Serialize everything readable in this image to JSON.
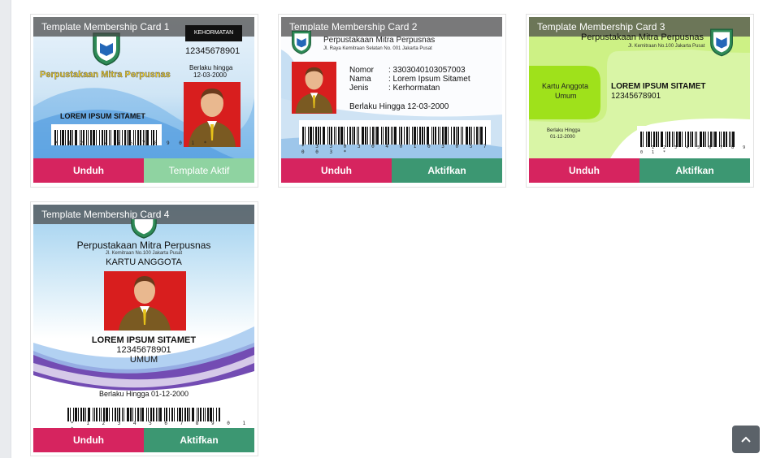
{
  "cards": [
    {
      "title": "Template Membership Card 1",
      "library": "Perpustakaan Mitra Perpusnas",
      "badge": "KEHORMATAN",
      "number": "12345678901",
      "valid_label": "Berlaku hingga",
      "valid_date": "12-03-2000",
      "name": "LOREM IPSUM SITAMET",
      "barcode_digits": "* 1 2 3 4 5 6 7 8 9 0 1 *",
      "download_label": "Unduh",
      "activate_label": "Template Aktif"
    },
    {
      "title": "Template Membership Card 2",
      "library": "Perpustakaan Mitra Perpusnas",
      "address": "Jl. Raya Kemitraan Selatan No. 001 Jakarta Pusat",
      "field_labels": [
        "Nomor",
        "Nama",
        "Jenis"
      ],
      "field_values": [
        ": 3303040103057003",
        ": Lorem Ipsum Sitamet",
        ": Kerhormatan"
      ],
      "valid_text": "Berlaku Hingga 12-03-2000",
      "barcode_digits": "* 3 3 0 3 0 4 0 1 0 3 0 5 7 0 0 3 *",
      "download_label": "Unduh",
      "activate_label": "Aktifkan"
    },
    {
      "title": "Template Membership Card 3",
      "library": "Perpustakaan Mitra Perpusnas",
      "address": "Jl. Kemitraan No.100 Jakarta Pusat",
      "member_type": "Kartu Anggota",
      "member_class": "Umum",
      "name": "LOREM IPSUM SITAMET",
      "number": "12345678901",
      "valid_label": "Berlaku Hingga",
      "valid_date": "01-12-2000",
      "barcode_digits": "* 1 2 3 4 5 6 7 8 9 0 1 *",
      "download_label": "Unduh",
      "activate_label": "Aktifkan"
    },
    {
      "title": "Template Membership Card 4",
      "library": "Perpustakaan Mitra Perpusnas",
      "address": "Jl. Kemitraan No.100 Jakarta Pusat",
      "heading": "KARTU ANGGOTA",
      "name": "LOREM IPSUM SITAMET",
      "number": "12345678901",
      "member_class": "UMUM",
      "valid_text": "Berlaku Hingga 01-12-2000",
      "barcode_digits": "* 1 2 3 4 5 6 7 8 9 0 1 *",
      "download_label": "Unduh",
      "activate_label": "Aktifkan"
    }
  ],
  "scroll_top_icon": "chevron-up-icon",
  "colors": {
    "download": "#d6245f",
    "activate": "#3c9772",
    "active": "#8fd3a1"
  }
}
